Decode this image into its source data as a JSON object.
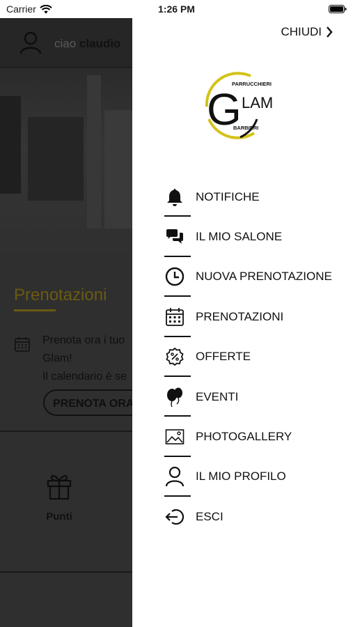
{
  "status_bar": {
    "carrier": "Carrier",
    "time": "1:26 PM"
  },
  "background_app": {
    "greeting_prefix": "ciao",
    "user_name": "claudio",
    "section_title": "Prenotazioni",
    "section_text_lines": [
      "Prenota ora i tuo",
      "Glam!",
      "Il calendario è se"
    ],
    "book_button": "PRENOTA ORA",
    "points_label": "Punti"
  },
  "drawer": {
    "close_label": "CHIUDI",
    "logo": {
      "top_text": "PARRUCCHIERI",
      "bottom_text": "BARBIERI",
      "brand_letter": "G",
      "brand_rest": "LAM",
      "accent_color": "#d4c21a"
    },
    "menu": [
      {
        "label": "NOTIFICHE",
        "icon": "bell-icon"
      },
      {
        "label": "IL MIO SALONE",
        "icon": "chat-bubbles-icon"
      },
      {
        "label": "NUOVA PRENOTAZIONE",
        "icon": "clock-icon"
      },
      {
        "label": "PRENOTAZIONI",
        "icon": "calendar-icon"
      },
      {
        "label": "OFFERTE",
        "icon": "discount-badge-icon"
      },
      {
        "label": "EVENTI",
        "icon": "balloons-icon"
      },
      {
        "label": "PHOTOGALLERY",
        "icon": "image-icon"
      },
      {
        "label": "IL MIO PROFILO",
        "icon": "user-icon"
      },
      {
        "label": "ESCI",
        "icon": "logout-icon"
      }
    ]
  }
}
